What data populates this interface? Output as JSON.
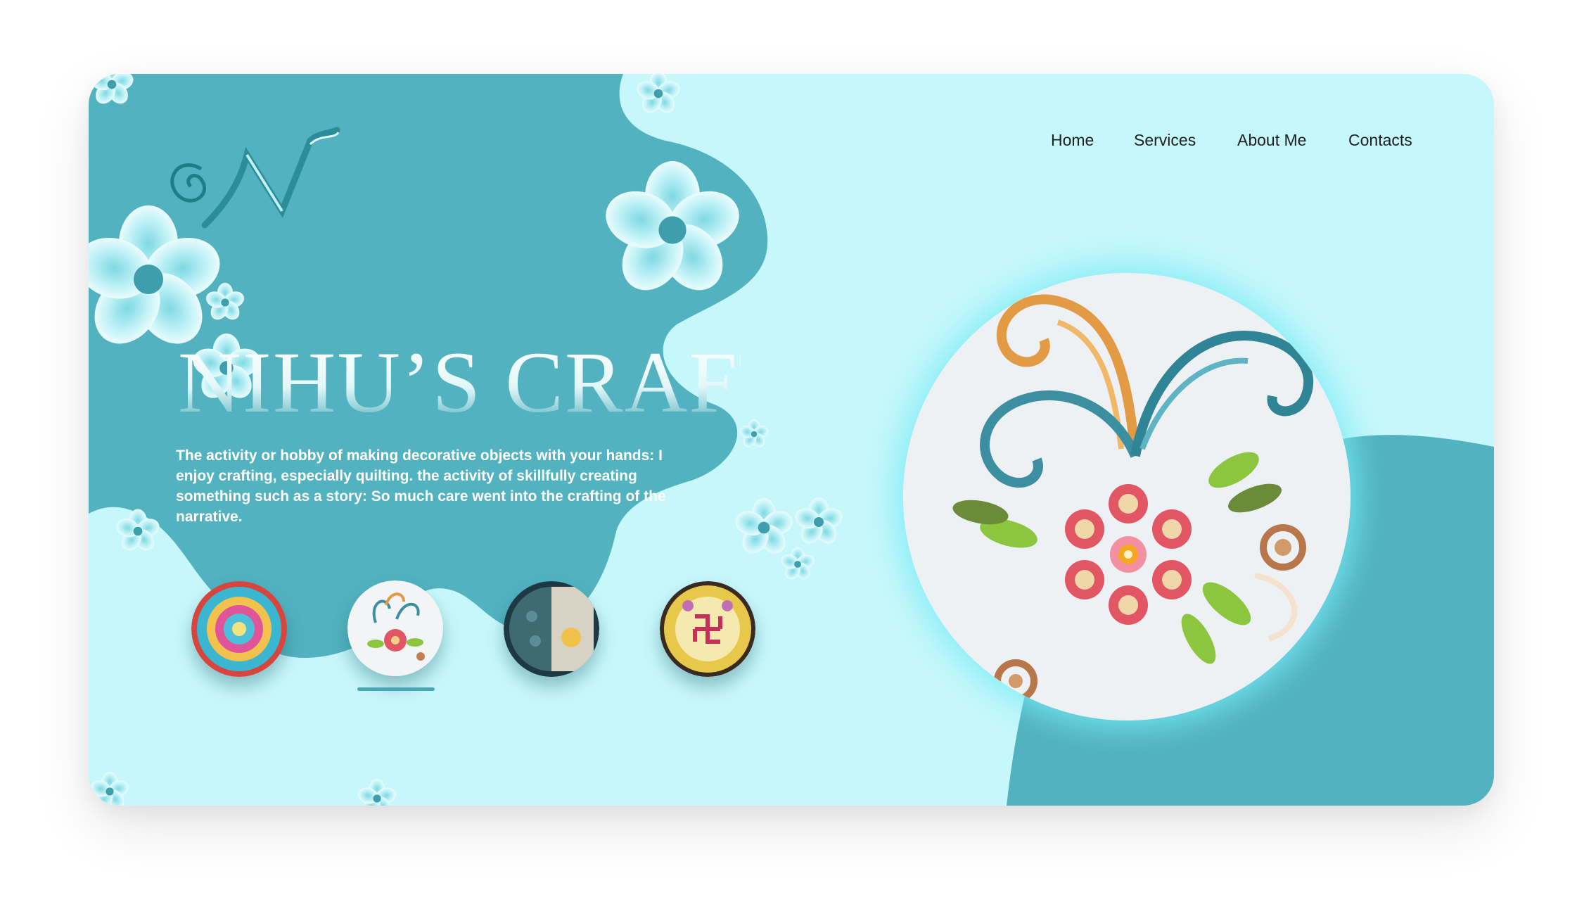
{
  "brand": {
    "logo_text": "N",
    "title": "NIHU’S CRAFT",
    "description": "The activity or hobby of making decorative objects with your hands: I enjoy crafting, especially quilting. the activity of skillfully creating something such as a story: So much care went into the crafting of the narrative."
  },
  "nav": {
    "items": [
      {
        "label": "Home"
      },
      {
        "label": "Services"
      },
      {
        "label": "About Me"
      },
      {
        "label": "Contacts"
      }
    ]
  },
  "gallery": {
    "selected_index": 1,
    "thumbnails": [
      {
        "icon": "mandala-quilling-icon"
      },
      {
        "icon": "floral-quilling-icon"
      },
      {
        "icon": "peacock-quilling-icon"
      },
      {
        "icon": "swastik-quilling-icon"
      }
    ]
  },
  "colors": {
    "card_background": "#c6f7fb",
    "teal_blob": "#52b2bf",
    "accent": "#4aa8b3",
    "nav_text": "#1f1f1f"
  }
}
